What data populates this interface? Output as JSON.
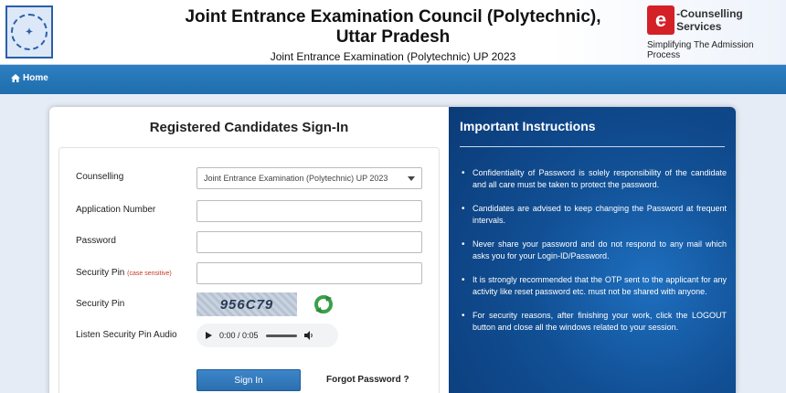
{
  "header": {
    "title_line1": "Joint Entrance Examination Council (Polytechnic),",
    "title_line2": "Uttar Pradesh",
    "subtitle": "Joint Entrance Examination (Polytechnic) UP 2023",
    "brand_mark": "e",
    "brand_name": "-Counselling Services",
    "brand_tagline": "Simplifying The Admission Process"
  },
  "nav": {
    "home_label": "Home"
  },
  "signin": {
    "title": "Registered Candidates Sign-In",
    "labels": {
      "counselling": "Counselling",
      "application_number": "Application Number",
      "password": "Password",
      "security_pin_input": "Security Pin",
      "case_note": "(case sensitive)",
      "security_pin_image": "Security Pin",
      "audio": "Listen Security Pin Audio"
    },
    "counselling_selected": "Joint Entrance Examination (Polytechnic) UP 2023",
    "application_number_value": "",
    "password_value": "",
    "security_pin_value": "",
    "captcha_text": "956C79",
    "audio_time": "0:00 / 0:05",
    "signin_button": "Sign In",
    "forgot_password": "Forgot Password ?"
  },
  "instructions": {
    "title": "Important Instructions",
    "items": [
      "Confidentiality of Password is solely responsibility of the candidate and all care must be taken to protect the password.",
      "Candidates are advised to keep changing the Password at frequent intervals.",
      "Never share your password and do not respond to any mail which asks you for your Login-ID/Password.",
      "It is strongly recommended that the OTP sent to the applicant for any activity like reset password etc. must not be shared with anyone.",
      "For security reasons, after finishing your work, click the LOGOUT button and close all the windows related to your session."
    ]
  },
  "colors": {
    "nav_blue": "#1f6ead",
    "panel_blue": "#114f94",
    "button_blue": "#2b6fb0",
    "brand_red": "#d42027"
  }
}
